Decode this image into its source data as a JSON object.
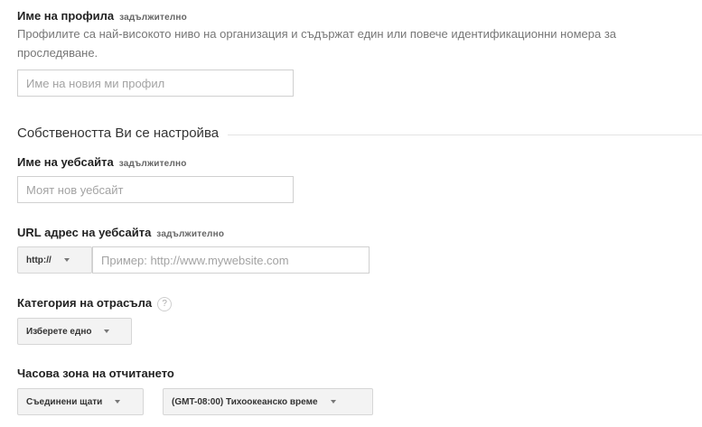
{
  "profile": {
    "label": "Име на профила",
    "required": "задължително",
    "help": "Профилите са най-високото ниво на организация и съдържат един или повече идентификационни номера за проследяване.",
    "placeholder": "Име на новия ми профил"
  },
  "property_section": {
    "title": "Собствеността Ви се настройва"
  },
  "website_name": {
    "label": "Име на уебсайта",
    "required": "задължително",
    "placeholder": "Моят нов уебсайт"
  },
  "url": {
    "label": "URL адрес на уебсайта",
    "required": "задължително",
    "protocol": "http://",
    "placeholder": "Пример: http://www.mywebsite.com"
  },
  "industry": {
    "label": "Категория на отрасъла",
    "help_icon": "?",
    "select": "Изберете едно"
  },
  "timezone": {
    "label": "Часова зона на отчитането",
    "country": "Съединени щати",
    "zone": "(GMT-08:00) Тихоокеанско време"
  },
  "colors": {
    "text": "#222222",
    "muted": "#777777",
    "border": "#d0d0d0",
    "button_bg": "#f3f3f3"
  }
}
